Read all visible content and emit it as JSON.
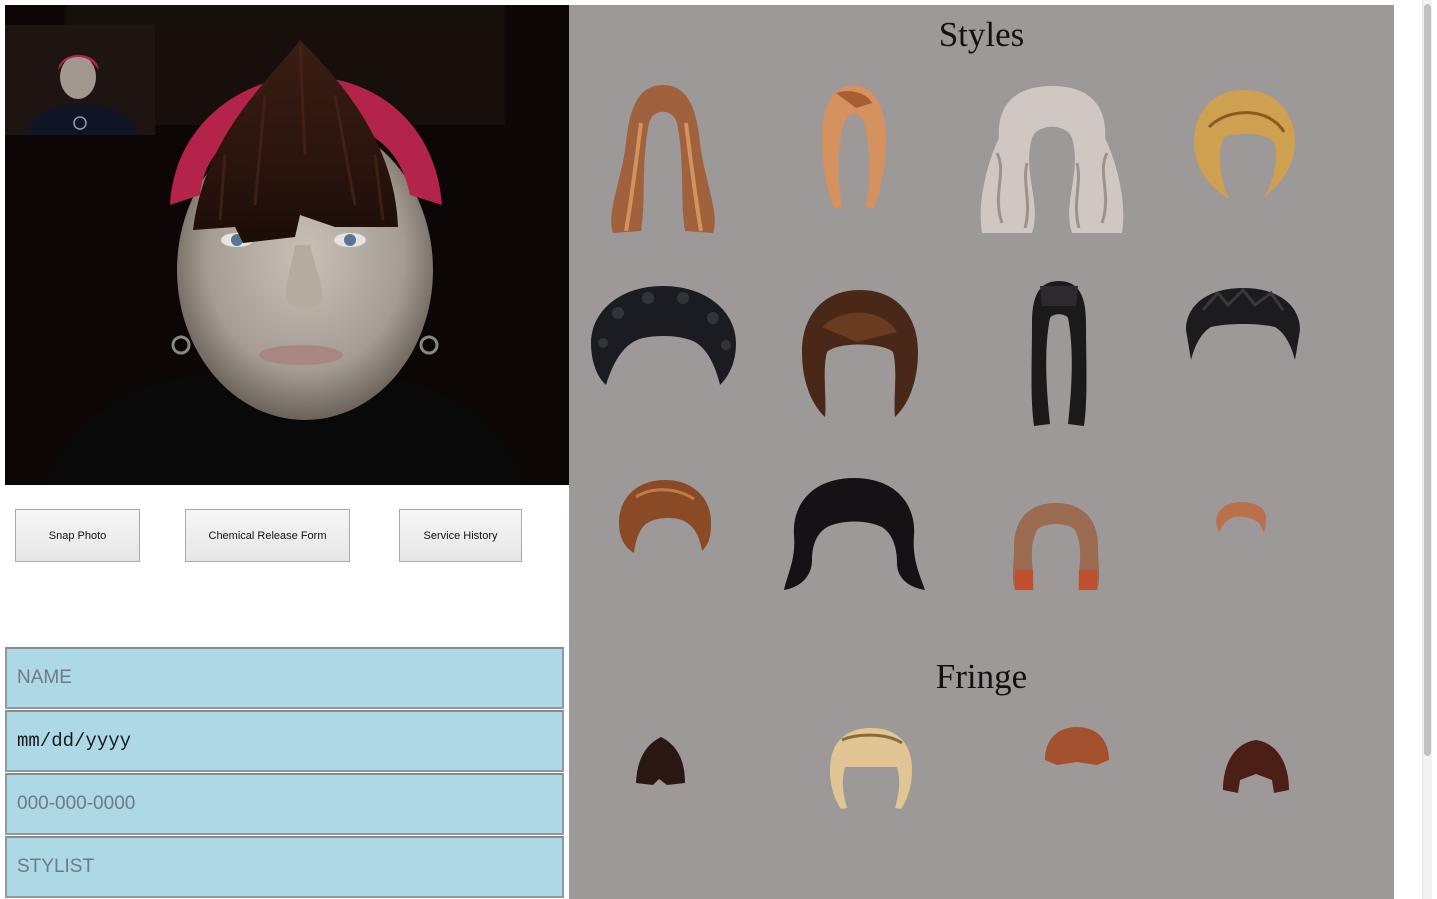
{
  "buttons": {
    "snap_photo": "Snap Photo",
    "chemical_release": "Chemical Release Form",
    "service_history": "Service History"
  },
  "form": {
    "name_placeholder": "NAME",
    "date_placeholder": "mm/dd/yyyy",
    "phone_placeholder": "000-000-0000",
    "stylist_placeholder": "STYLIST"
  },
  "styles_section": {
    "title": "Styles",
    "items": [
      {
        "icon": "long-wavy-auburn-hair-icon"
      },
      {
        "icon": "strawberry-blonde-bob-hair-icon"
      },
      {
        "icon": "platinum-long-curly-hair-icon"
      },
      {
        "icon": "golden-blonde-bob-hair-icon"
      },
      {
        "icon": "black-afro-hair-icon"
      },
      {
        "icon": "brown-layered-bob-hair-icon"
      },
      {
        "icon": "long-straight-black-hair-icon"
      },
      {
        "icon": "short-black-spiky-hair-icon"
      },
      {
        "icon": "short-auburn-messy-hair-icon"
      },
      {
        "icon": "black-shag-hair-icon"
      },
      {
        "icon": "ombre-shoulder-hair-icon"
      },
      {
        "icon": "short-ginger-crop-hair-icon"
      }
    ]
  },
  "fringe_section": {
    "title": "Fringe",
    "items": [
      {
        "icon": "dark-brown-fringe-icon"
      },
      {
        "icon": "blonde-fringe-icon"
      },
      {
        "icon": "copper-fringe-icon"
      },
      {
        "icon": "mahogany-fringe-icon"
      }
    ]
  },
  "colors": {
    "field_background": "#add8e6",
    "panel_background": "#9e9999",
    "camera_background": "#0a0606"
  }
}
